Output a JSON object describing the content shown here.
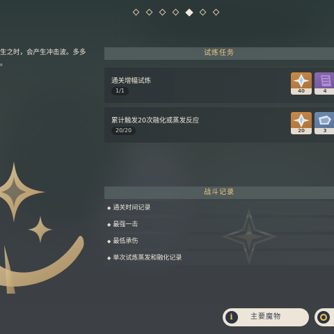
{
  "pagination": {
    "total": 7,
    "active_index": 4
  },
  "description": {
    "text": "生之时，会产生冲击波。多多\n。"
  },
  "trial_tasks": {
    "header": "试炼任务",
    "tasks": [
      {
        "title": "通关增幅试炼",
        "progress": "1/1",
        "rewards": [
          {
            "icon": "primogem-icon",
            "count": "40",
            "rarity": "gold"
          },
          {
            "icon": "purple-book-icon",
            "count": "4",
            "rarity": "purple"
          }
        ]
      },
      {
        "title": "累计触发20次融化或蒸发反应",
        "progress": "20/20",
        "rewards": [
          {
            "icon": "primogem-icon",
            "count": "20",
            "rarity": "gold"
          },
          {
            "icon": "blue-material-icon",
            "count": "3",
            "rarity": "blue"
          }
        ]
      }
    ]
  },
  "combat_record": {
    "header": "战斗记录",
    "rows": [
      "通关时间记录",
      "最强一击",
      "最低承伤",
      "单次试炼蒸发和融化记录"
    ]
  },
  "buttons": {
    "main_monsters": "主要魔物"
  },
  "colors": {
    "accent_gold": "#e9c77b",
    "button_bg": "#ece5d8",
    "button_text": "#3b4354"
  }
}
